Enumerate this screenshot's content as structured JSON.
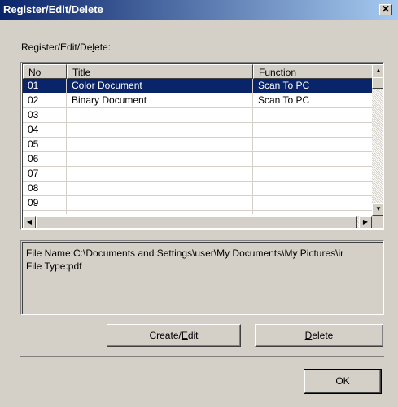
{
  "window": {
    "title": "Register/Edit/Delete",
    "close_glyph": "✕"
  },
  "group_label": "Register/Edit/Delete:",
  "table": {
    "columns": [
      "No",
      "Title",
      "Function"
    ],
    "rows": [
      {
        "no": "01",
        "title": "Color Document",
        "function": "Scan To PC",
        "selected": true
      },
      {
        "no": "02",
        "title": "Binary Document",
        "function": "Scan To PC",
        "selected": false
      },
      {
        "no": "03",
        "title": "",
        "function": "",
        "selected": false
      },
      {
        "no": "04",
        "title": "",
        "function": "",
        "selected": false
      },
      {
        "no": "05",
        "title": "",
        "function": "",
        "selected": false
      },
      {
        "no": "06",
        "title": "",
        "function": "",
        "selected": false
      },
      {
        "no": "07",
        "title": "",
        "function": "",
        "selected": false
      },
      {
        "no": "08",
        "title": "",
        "function": "",
        "selected": false
      },
      {
        "no": "09",
        "title": "",
        "function": "",
        "selected": false
      }
    ]
  },
  "info": {
    "file_name": "File Name:C:\\Documents and Settings\\user\\My Documents\\My Pictures\\ir",
    "file_type": "File Type:pdf"
  },
  "buttons": {
    "create_edit": {
      "pre": "Create/",
      "accel": "E",
      "post": "dit"
    },
    "delete": {
      "pre": "",
      "accel": "D",
      "post": "elete"
    },
    "ok": "OK"
  },
  "colors": {
    "selection": "#0a246a",
    "face": "#d4d0c8",
    "title_gradient_start": "#0a246a",
    "title_gradient_end": "#a6caf0"
  },
  "icons": {
    "close": "close-icon",
    "scroll_up": "arrow-up-icon",
    "scroll_down": "arrow-down-icon",
    "scroll_left": "arrow-left-icon",
    "scroll_right": "arrow-right-icon"
  }
}
